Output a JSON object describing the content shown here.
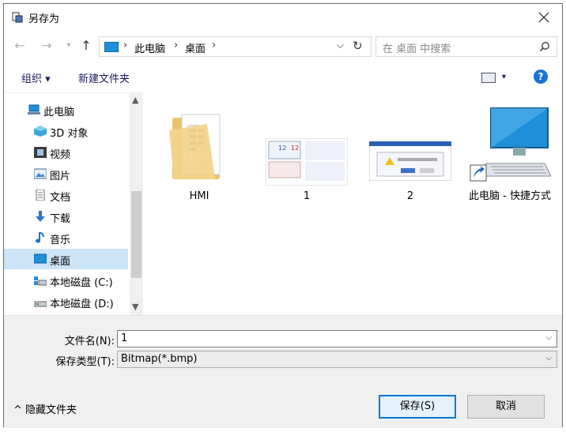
{
  "title": "另存为",
  "nav": {
    "path": [
      "此电脑",
      "桌面"
    ],
    "search_placeholder": "在 桌面 中搜索"
  },
  "toolbar": {
    "organize": "组织 ▾",
    "new_folder": "新建文件夹"
  },
  "tree": [
    {
      "label": "此电脑",
      "icon": "computer-icon"
    },
    {
      "label": "3D 对象",
      "icon": "3d-objects-icon"
    },
    {
      "label": "视频",
      "icon": "video-icon"
    },
    {
      "label": "图片",
      "icon": "pictures-icon"
    },
    {
      "label": "文档",
      "icon": "documents-icon"
    },
    {
      "label": "下载",
      "icon": "download-icon"
    },
    {
      "label": "音乐",
      "icon": "music-icon"
    },
    {
      "label": "桌面",
      "icon": "desktop-icon",
      "selected": true
    },
    {
      "label": "本地磁盘 (C:)",
      "icon": "drive-c-icon"
    },
    {
      "label": "本地磁盘 (D:)",
      "icon": "drive-d-icon"
    }
  ],
  "files": [
    {
      "label": "HMI",
      "type": "folder"
    },
    {
      "label": "1",
      "type": "image"
    },
    {
      "label": "2",
      "type": "image"
    },
    {
      "label": "此电脑 - 快捷方式",
      "type": "shortcut"
    }
  ],
  "thumb1": {
    "num_a": "12",
    "num_b": "12"
  },
  "form": {
    "filename_label": "文件名(N):",
    "filename_value": "1",
    "filetype_label": "保存类型(T):",
    "filetype_value": "Bitmap(*.bmp)"
  },
  "footer": {
    "hide_folders": "^ 隐藏文件夹",
    "save": "保存(S)",
    "cancel": "取消"
  },
  "colors": {
    "accent": "#0078d7",
    "selection": "#cce4f7"
  }
}
